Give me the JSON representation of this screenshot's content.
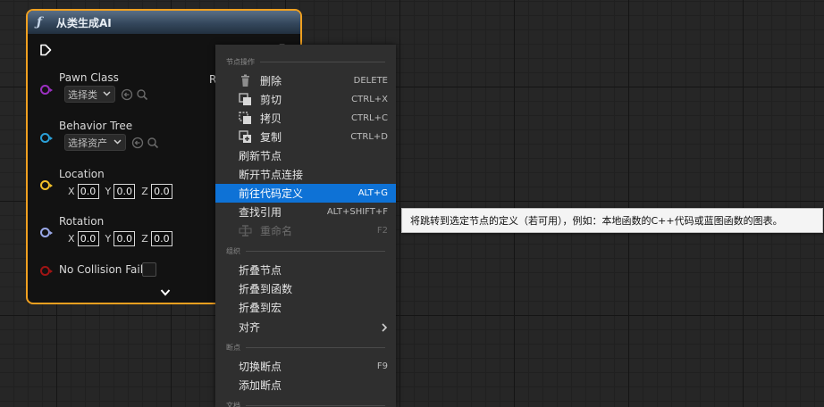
{
  "node": {
    "icon": "function-icon",
    "title": "从类生成AI",
    "return_fragment": "R",
    "pins": [
      {
        "label": "Pawn Class",
        "color": "#9b30c0",
        "combo": "选择类"
      },
      {
        "label": "Behavior Tree",
        "color": "#2a9fd6",
        "combo": "选择资产"
      },
      {
        "label": "Location",
        "color": "#f2c029",
        "vector": {
          "x": "0.0",
          "y": "0.0",
          "z": "0.0"
        }
      },
      {
        "label": "Rotation",
        "color": "#9aa8e8",
        "vector": {
          "x": "0.0",
          "y": "0.0",
          "z": "0.0"
        }
      },
      {
        "label": "No Collision Fail",
        "color": "#a01414"
      }
    ],
    "axis_labels": {
      "x": "X",
      "y": "Y",
      "z": "Z"
    }
  },
  "menu": {
    "section_node_ops": "节点操作",
    "section_organize": "组织",
    "section_breakpoints": "断点",
    "section_docs": "文档",
    "items": [
      {
        "label": "删除",
        "shortcut": "DELETE",
        "icon": "trash-icon"
      },
      {
        "label": "剪切",
        "shortcut": "CTRL+X",
        "icon": "cut-icon"
      },
      {
        "label": "拷贝",
        "shortcut": "CTRL+C",
        "icon": "copy-icon"
      },
      {
        "label": "复制",
        "shortcut": "CTRL+D",
        "icon": "duplicate-icon"
      },
      {
        "label": "刷新节点",
        "shortcut": ""
      },
      {
        "label": "断开节点连接",
        "shortcut": ""
      },
      {
        "label": "前往代码定义",
        "shortcut": "ALT+G"
      },
      {
        "label": "查找引用",
        "shortcut": "ALT+SHIFT+F"
      },
      {
        "label": "重命名",
        "shortcut": "F2",
        "icon": "rename-icon"
      },
      {
        "label": "折叠节点",
        "shortcut": ""
      },
      {
        "label": "折叠到函数",
        "shortcut": ""
      },
      {
        "label": "折叠到宏",
        "shortcut": ""
      },
      {
        "label": "对齐",
        "shortcut": ""
      },
      {
        "label": "切换断点",
        "shortcut": "F9"
      },
      {
        "label": "添加断点",
        "shortcut": ""
      }
    ]
  },
  "tooltip": "将跳转到选定节点的定义（若可用），例如：本地函数的C++代码或蓝图函数的图表。",
  "colors": {
    "accent": "#0e72d6",
    "node_border": "#f0a020"
  }
}
